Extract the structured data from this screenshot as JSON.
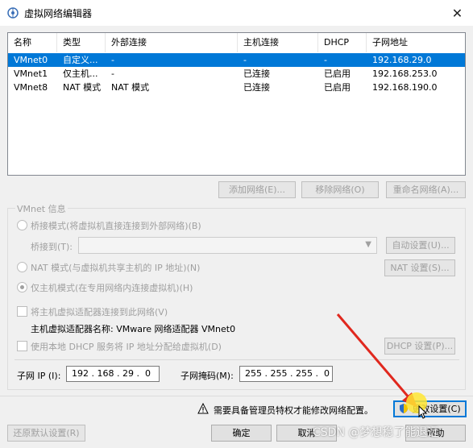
{
  "window": {
    "title": "虚拟网络编辑器",
    "close_glyph": "✕"
  },
  "table": {
    "headers": [
      "名称",
      "类型",
      "外部连接",
      "主机连接",
      "DHCP",
      "子网地址"
    ],
    "rows": [
      [
        "VMnet0",
        "自定义...",
        "-",
        "-",
        "-",
        "192.168.29.0"
      ],
      [
        "VMnet1",
        "仅主机...",
        "-",
        "已连接",
        "已启用",
        "192.168.253.0"
      ],
      [
        "VMnet8",
        "NAT 模式",
        "NAT 模式",
        "已连接",
        "已启用",
        "192.168.190.0"
      ]
    ],
    "selected_row": 0
  },
  "network_buttons": {
    "add": "添加网络(E)...",
    "remove": "移除网络(O)",
    "rename": "重命名网络(A)..."
  },
  "vmnet_info": {
    "group_title": "VMnet 信息",
    "bridged_label": "桥接模式(将虚拟机直接连接到外部网络)(B)",
    "bridged_to_label": "桥接到(T):",
    "bridged_to_value": "",
    "auto_settings": "自动设置(U)...",
    "nat_label": "NAT 模式(与虚拟机共享主机的 IP 地址)(N)",
    "nat_settings": "NAT 设置(S)...",
    "hostonly_label": "仅主机模式(在专用网络内连接虚拟机)(H)",
    "selected_mode": "host-only",
    "connect_adapter_label": "将主机虚拟适配器连接到此网络(V)",
    "adapter_name_label": "主机虚拟适配器名称: VMware 网络适配器 VMnet0",
    "dhcp_label": "使用本地 DHCP 服务将 IP 地址分配给虚拟机(D)",
    "dhcp_settings": "DHCP 设置(P)...",
    "subnet_ip_label": "子网 IP (I):",
    "subnet_ip_value": "192 . 168 . 29 .  0",
    "subnet_mask_label": "子网掩码(M):",
    "subnet_mask_value": "255 . 255 . 255 .  0"
  },
  "footer": {
    "admin_warning": "需要具备管理员特权才能修改网络配置。",
    "change_settings": "更改设置(C)",
    "restore_defaults": "还原默认设置(R)",
    "ok": "确定",
    "cancel": "取消",
    "help": "帮助"
  },
  "watermark": "CSDN @梦想稳了能退远",
  "colors": {
    "selection": "#0078d7",
    "annotation_arrow": "#e0281e",
    "highlight": "#ffe632"
  }
}
